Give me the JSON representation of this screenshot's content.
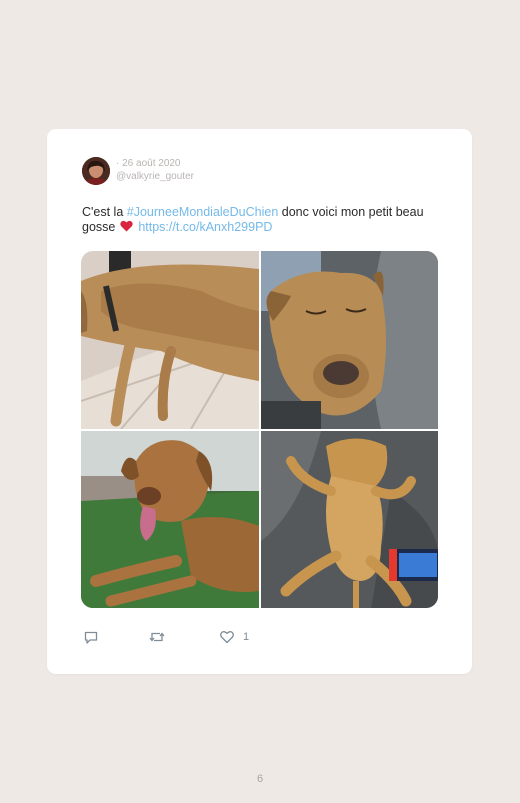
{
  "tweet": {
    "date": "26 août 2020",
    "handle": "@valkyrie_gouter",
    "text_before": "C'est la",
    "hashtag": "#JourneeMondialeDuChien",
    "text_after": "donc voici mon petit beau gosse",
    "emoji": "red-heart",
    "link": "https://t.co/kAnxh299PD",
    "photos": [
      "dog-lying-on-tiles-photo",
      "dog-sleeping-against-sofa-photo",
      "dog-on-artificial-grass-photo",
      "dog-on-back-with-game-console-photo"
    ],
    "actions": {
      "reply_icon": "reply-icon",
      "retweet_icon": "retweet-icon",
      "like_icon": "heart-outline-icon",
      "like_count": "1"
    }
  },
  "page": {
    "number": "6"
  }
}
